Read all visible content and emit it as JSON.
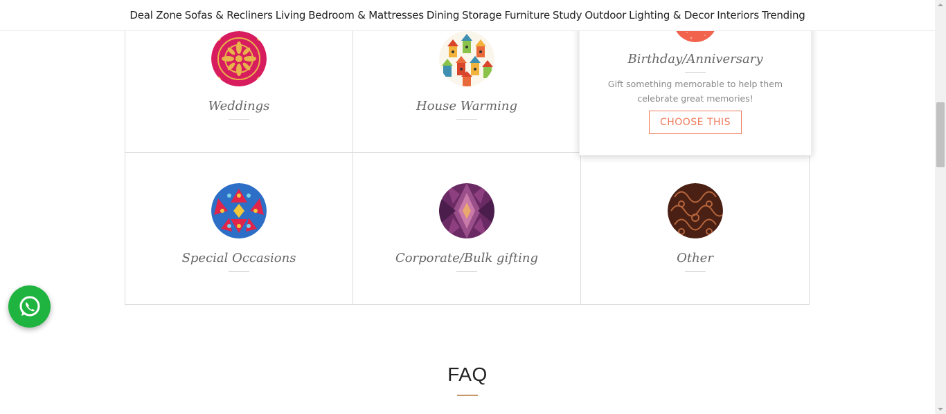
{
  "nav": {
    "items": [
      "Deal Zone",
      "Sofas & Recliners",
      "Living",
      "Bedroom & Mattresses",
      "Dining",
      "Storage",
      "Furniture",
      "Study",
      "Outdoor",
      "Lighting & Decor",
      "Interiors",
      "Trending"
    ]
  },
  "occasions": [
    {
      "title": "Weddings",
      "icon": "mandala-pink-gold"
    },
    {
      "title": "House Warming",
      "icon": "birdhouses-pattern"
    },
    {
      "title": "Birthday/Anniversary",
      "icon": "coral-speckle",
      "description": "Gift something memorable to help them celebrate great memories!",
      "cta": "CHOOSE THIS"
    },
    {
      "title": "Special Occasions",
      "icon": "kaleidoscope-blue-red"
    },
    {
      "title": "Corporate/Bulk gifting",
      "icon": "kaleidoscope-purple"
    },
    {
      "title": "Other",
      "icon": "paisley-brown"
    }
  ],
  "faq": {
    "heading": "FAQ"
  },
  "colors": {
    "accent": "#f07a5b",
    "whatsapp": "#1fb340",
    "faq_rule": "#c79a6b"
  },
  "floating": {
    "icon": "whatsapp-icon"
  }
}
